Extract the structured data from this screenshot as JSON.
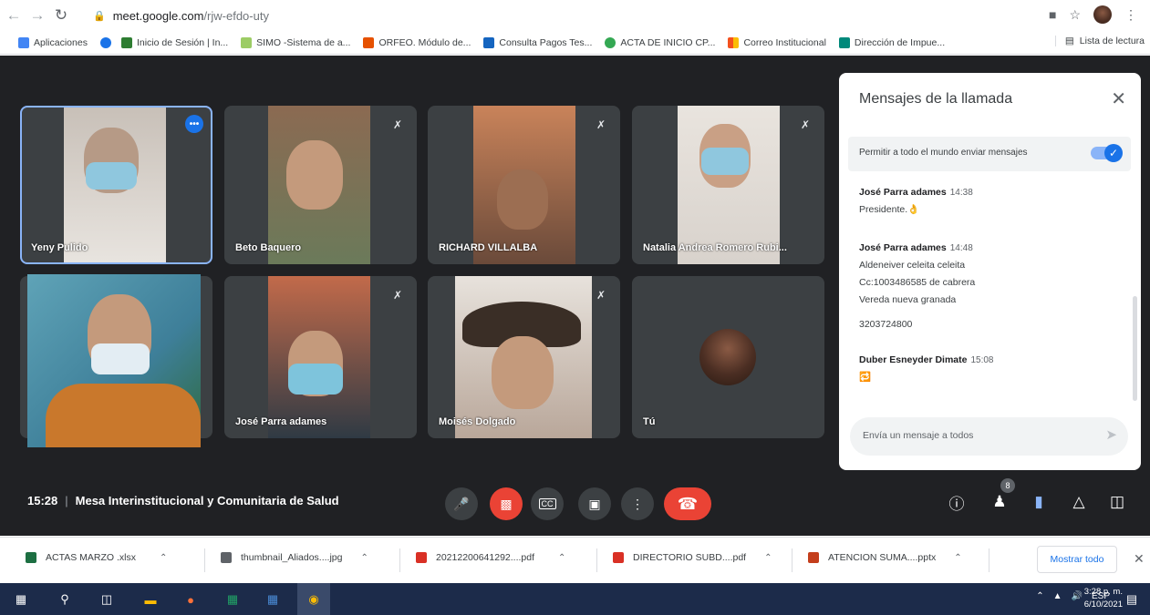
{
  "browser": {
    "url_host": "meet.google.com",
    "url_path": "/rjw-efdo-uty",
    "bookmarks": [
      {
        "label": "Aplicaciones",
        "color": "#4285f4"
      },
      {
        "label": "",
        "color": "#1a73e8"
      },
      {
        "label": "Inicio de Sesión | In...",
        "color": "#2e7d32"
      },
      {
        "label": "SIMO -Sistema de a...",
        "color": "#9ccc65"
      },
      {
        "label": "ORFEO. Módulo de...",
        "color": "#e65100"
      },
      {
        "label": "Consulta Pagos Tes...",
        "color": "#1565c0"
      },
      {
        "label": "ACTA DE INICIO CP...",
        "color": "#34a853"
      },
      {
        "label": "Correo Institucional",
        "color": "#f4511e"
      },
      {
        "label": "Dirección de Impue...",
        "color": "#00897b"
      }
    ],
    "reading_list": "Lista de lectura"
  },
  "participants": [
    {
      "name": "Yeny Pulido",
      "muted": false,
      "speaking": true
    },
    {
      "name": "Beto Baquero",
      "muted": true
    },
    {
      "name": "RICHARD VILLALBA",
      "muted": true
    },
    {
      "name": "Natalia Andrea Romero Rubi...",
      "muted": true
    },
    {
      "name": "José Parra adames",
      "muted": true
    },
    {
      "name": "Moisés Dolgado",
      "muted": true
    },
    {
      "name": "Tú",
      "muted": false
    }
  ],
  "chat": {
    "title": "Mensajes de la llamada",
    "allow_label": "Permitir a todo el mundo enviar mensajes",
    "allow_enabled": true,
    "messages": [
      {
        "sender": "José Parra adames",
        "time": "14:38",
        "lines": [
          "Presidente.👌"
        ]
      },
      {
        "sender": "José Parra adames",
        "time": "14:48",
        "lines": [
          "Aldeneiver celeita celeita",
          "Cc:1003486585 de cabrera",
          "Vereda nueva granada",
          "",
          "3203724800"
        ]
      },
      {
        "sender": "Duber Esneyder Dimate",
        "time": "15:08",
        "lines": [
          "🔁"
        ]
      }
    ],
    "input_placeholder": "Envía un mensaje a todos"
  },
  "meeting": {
    "time": "15:28",
    "separator": "|",
    "title": "Mesa Interinstitucional y Comunitaria de Salud",
    "participant_count": "8"
  },
  "downloads": {
    "items": [
      {
        "label": "ACTAS MARZO .xlsx",
        "color": "#1d6f42"
      },
      {
        "label": "thumbnail_Aliados....jpg",
        "color": "#5f6368"
      },
      {
        "label": "20212200641292....pdf",
        "color": "#d93025"
      },
      {
        "label": "DIRECTORIO SUBD....pdf",
        "color": "#d93025"
      },
      {
        "label": "ATENCION SUMA....pptx",
        "color": "#c43e1c"
      }
    ],
    "show_all": "Mostrar todo"
  },
  "taskbar": {
    "lang": "ESP",
    "time": "3:28 p. m.",
    "date": "6/10/2021"
  }
}
